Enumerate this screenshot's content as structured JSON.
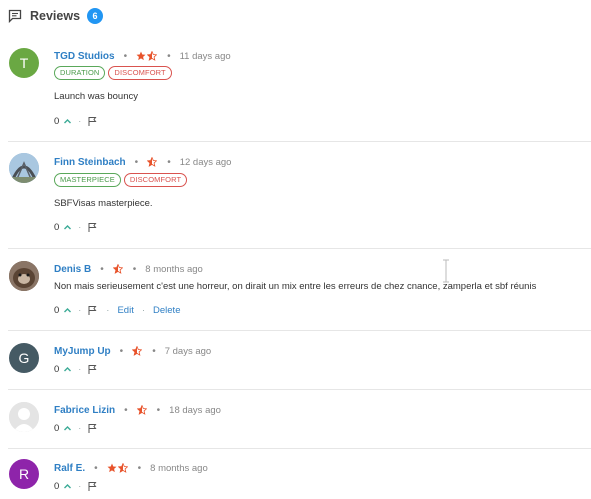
{
  "header": {
    "title": "Reviews",
    "count": "6"
  },
  "reviews": [
    {
      "author": "TGD Studios",
      "avatar_letter": "T",
      "avatar_color": "#6aa843",
      "stars": "1.5",
      "time": "11 days ago",
      "tags": [
        "DURATION",
        "DISCOMFORT"
      ],
      "text": "Launch was bouncy",
      "votes": "0"
    },
    {
      "author": "Finn Steinbach",
      "avatar_letter": "",
      "avatar_color": "#7a9fc0",
      "stars": "0.5",
      "time": "12 days ago",
      "tags": [
        "MASTERPIECE",
        "DISCOMFORT"
      ],
      "text": "SBFVisas masterpiece.",
      "votes": "0"
    },
    {
      "author": "Denis B",
      "avatar_letter": "",
      "avatar_color": "#6b5544",
      "stars": "0.5",
      "time": "8 months ago",
      "tags": [],
      "text": "Non mais serieusement c'est une horreur, on dirait un mix entre les erreurs de chez cnance, zamperla et sbf réunis",
      "votes": "0",
      "edit_label": "Edit",
      "delete_label": "Delete"
    },
    {
      "author": "MyJump Up",
      "avatar_letter": "G",
      "avatar_color": "#455a64",
      "stars": "0.5",
      "time": "7 days ago",
      "tags": [],
      "text": "",
      "votes": "0"
    },
    {
      "author": "Fabrice Lizin",
      "avatar_letter": "",
      "avatar_color": "#e8e8e8",
      "stars": "0.5",
      "time": "18 days ago",
      "tags": [],
      "text": "",
      "votes": "0"
    },
    {
      "author": "Ralf E.",
      "avatar_letter": "R",
      "avatar_color": "#8e24aa",
      "stars": "1.5",
      "time": "8 months ago",
      "tags": [],
      "text": "",
      "votes": "0"
    }
  ],
  "colors": {
    "accent": "#2f7fc4",
    "star": "#e8532b",
    "badge": "#2196f3",
    "upvote": "#3aaa96"
  }
}
